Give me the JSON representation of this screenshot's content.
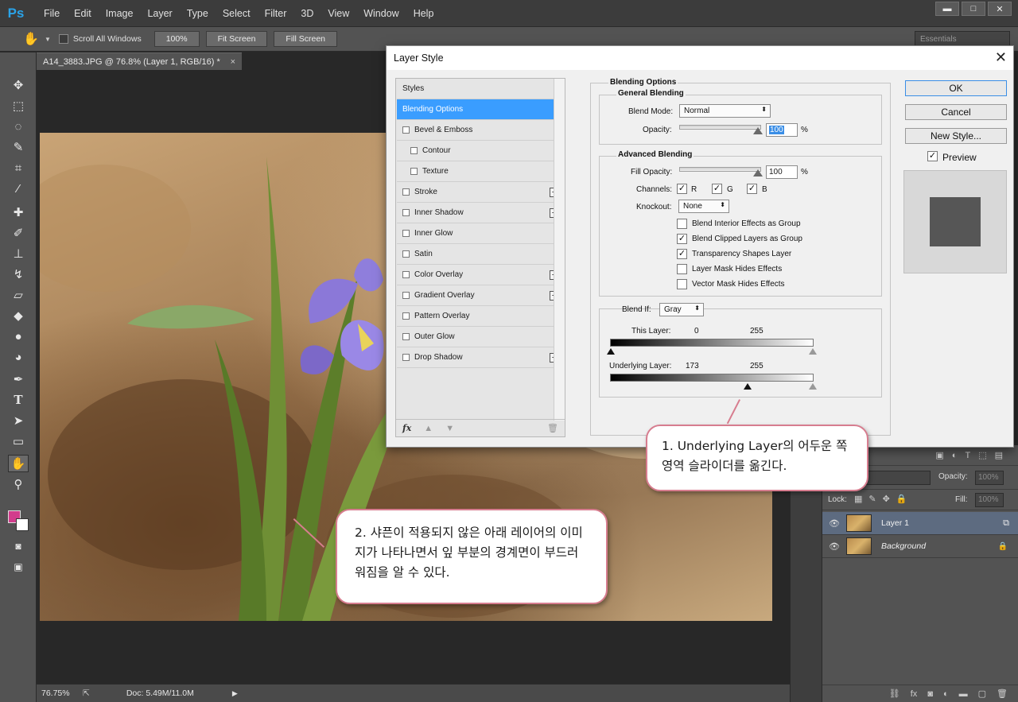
{
  "app": {
    "logo": "Ps",
    "menu": [
      "File",
      "Edit",
      "Image",
      "Layer",
      "Type",
      "Select",
      "Filter",
      "3D",
      "View",
      "Window",
      "Help"
    ],
    "window_controls": {
      "minimize": "▬",
      "maximize": "□",
      "close": "✕"
    }
  },
  "options_bar": {
    "scroll_all_windows": "Scroll All Windows",
    "btn_100": "100%",
    "btn_fit": "Fit Screen",
    "btn_fill": "Fill Screen",
    "workspace": "Essentials"
  },
  "document": {
    "tab_title": "A14_3883.JPG @ 76.8% (Layer 1, RGB/16) *",
    "close": "×",
    "status_zoom": "76.75%",
    "status_doc": "Doc: 5.49M/11.0M"
  },
  "dialog": {
    "title": "Layer Style",
    "close": "✕",
    "styles_header": "Styles",
    "style_items": [
      {
        "label": "Blending Options",
        "active": true
      },
      {
        "label": "Bevel & Emboss",
        "checkbox": true
      },
      {
        "label": "Contour",
        "checkbox": true,
        "indent": true
      },
      {
        "label": "Texture",
        "checkbox": true,
        "indent": true
      },
      {
        "label": "Stroke",
        "checkbox": true,
        "plus": true
      },
      {
        "label": "Inner Shadow",
        "checkbox": true,
        "plus": true
      },
      {
        "label": "Inner Glow",
        "checkbox": true
      },
      {
        "label": "Satin",
        "checkbox": true
      },
      {
        "label": "Color Overlay",
        "checkbox": true,
        "plus": true
      },
      {
        "label": "Gradient Overlay",
        "checkbox": true,
        "plus": true
      },
      {
        "label": "Pattern Overlay",
        "checkbox": true
      },
      {
        "label": "Outer Glow",
        "checkbox": true
      },
      {
        "label": "Drop Shadow",
        "checkbox": true,
        "plus": true
      }
    ],
    "fx_label": "fx",
    "blending_options": "Blending Options",
    "general_blending": "General Blending",
    "blend_mode_label": "Blend Mode:",
    "blend_mode_value": "Normal",
    "opacity_label": "Opacity:",
    "opacity_value": "100",
    "percent": "%",
    "advanced_blending": "Advanced Blending",
    "fill_opacity_label": "Fill Opacity:",
    "fill_opacity_value": "100",
    "channels_label": "Channels:",
    "channel_r": "R",
    "channel_g": "G",
    "channel_b": "B",
    "knockout_label": "Knockout:",
    "knockout_value": "None",
    "options": [
      {
        "label": "Blend Interior Effects as Group",
        "checked": false
      },
      {
        "label": "Blend Clipped Layers as Group",
        "checked": true
      },
      {
        "label": "Transparency Shapes Layer",
        "checked": true
      },
      {
        "label": "Layer Mask Hides Effects",
        "checked": false
      },
      {
        "label": "Vector Mask Hides Effects",
        "checked": false
      }
    ],
    "blend_if_label": "Blend If:",
    "blend_if_value": "Gray",
    "this_layer_label": "This Layer:",
    "this_layer_low": "0",
    "this_layer_high": "255",
    "underlying_label": "Underlying Layer:",
    "underlying_low": "173",
    "underlying_high": "255",
    "ok": "OK",
    "cancel": "Cancel",
    "new_style": "New Style...",
    "preview_label": "Preview"
  },
  "layers_panel": {
    "opacity_label": "Opacity:",
    "opacity_value": "100%",
    "fill_label": "Fill:",
    "fill_value": "100%",
    "lock_label": "Lock:",
    "layers": [
      {
        "name": "Layer 1",
        "selected": true
      },
      {
        "name": "Background",
        "locked": true
      }
    ]
  },
  "callouts": {
    "callout1": "1. Underlying Layer의 어두운 쪽 영역 슬라이더를 옮긴다.",
    "callout2": "2. 샤픈이 적용되지 않은 아래 레이어의 이미지가 나타나면서 잎 부분의 경계면이 부드러워짐을 알 수 있다."
  },
  "colors": {
    "accent": "#3a9dff",
    "callout_border": "#d77d8f",
    "foreground_swatch": "#d23c8c"
  }
}
